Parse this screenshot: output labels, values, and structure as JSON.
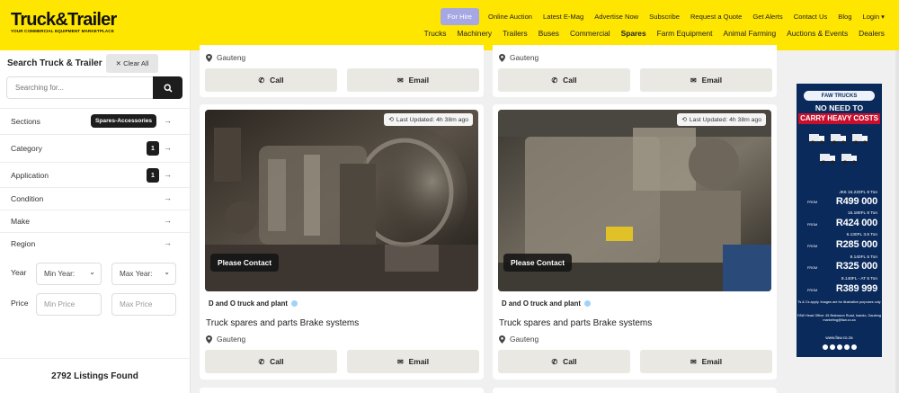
{
  "header": {
    "logo_text": "Truck&Trailer",
    "logo_tagline": "YOUR COMMERCIAL EQUIPMENT MARKETPLACE",
    "for_hire": "For Hire",
    "top_links": [
      "Online Auction",
      "Latest E-Mag",
      "Advertise Now",
      "Subscribe",
      "Request a Quote",
      "Get Alerts",
      "Contact Us",
      "Blog",
      "Login ▾"
    ],
    "nav": [
      "Trucks",
      "Machinery",
      "Trailers",
      "Buses",
      "Commercial",
      "Spares",
      "Farm Equipment",
      "Animal Farming",
      "Auctions & Events",
      "Dealers"
    ],
    "active_nav": "Spares"
  },
  "sidebar": {
    "title": "Search Truck & Trailer",
    "clear_all": "✕ Clear All",
    "search_placeholder": "Searching for...",
    "sections_label": "Sections",
    "sections_value": "Spares-Accessories",
    "category_label": "Category",
    "category_count": "1",
    "application_label": "Application",
    "application_count": "1",
    "condition_label": "Condition",
    "make_label": "Make",
    "region_label": "Region",
    "year_label": "Year",
    "min_year": "Min Year:",
    "max_year": "Max Year:",
    "price_label": "Price",
    "min_price_placeholder": "Min Price",
    "max_price_placeholder": "Max Price",
    "listings_found": "2792 Listings Found"
  },
  "listings": {
    "top_cards": [
      {
        "location": "Gauteng",
        "call": "Call",
        "email": "Email"
      },
      {
        "location": "Gauteng",
        "call": "Call",
        "email": "Email"
      }
    ],
    "cards": [
      {
        "updated": "Last Updated: 4h 38m ago",
        "contact": "Please Contact",
        "dealer": "D and O truck and plant",
        "title": "Truck spares and parts Brake systems",
        "location": "Gauteng",
        "call": "Call",
        "email": "Email"
      },
      {
        "updated": "Last Updated: 4h 38m ago",
        "contact": "Please Contact",
        "dealer": "D and O truck and plant",
        "title": "Truck spares and parts Brake systems",
        "location": "Gauteng",
        "call": "Call",
        "email": "Email"
      }
    ]
  },
  "ad": {
    "brand": "FAW TRUCKS",
    "headline_1": "NO NEED TO",
    "headline_2": "CARRY HEAVY COSTS",
    "offers": [
      {
        "model": "JK6 15.220FL 8 Ton",
        "from": "FROM",
        "price": "R499 000"
      },
      {
        "model": "15.180FL 8 Ton",
        "from": "FROM",
        "price": "R424 000"
      },
      {
        "model": "6.130FL 3.5 Ton",
        "from": "FROM",
        "price": "R285 000"
      },
      {
        "model": "8.140FL 5 Ton",
        "from": "FROM",
        "price": "R325 000"
      },
      {
        "model": "8.140FL - AT 5 Ton",
        "from": "FROM",
        "price": "R389 999"
      }
    ],
    "fineprint": "Ts & Cs apply. Images are for illustrative purposes only",
    "office": "FAW Head Office: 45 Brabazon Road, Isando, Gauteng marketing@faw.co.za",
    "website": "www.faw.co.za"
  },
  "colors": {
    "header_bg": "#ffe600",
    "for_hire_bg": "#a6a8e4",
    "dark": "#1d1d1d",
    "ad_bg": "#0b2a5c"
  }
}
